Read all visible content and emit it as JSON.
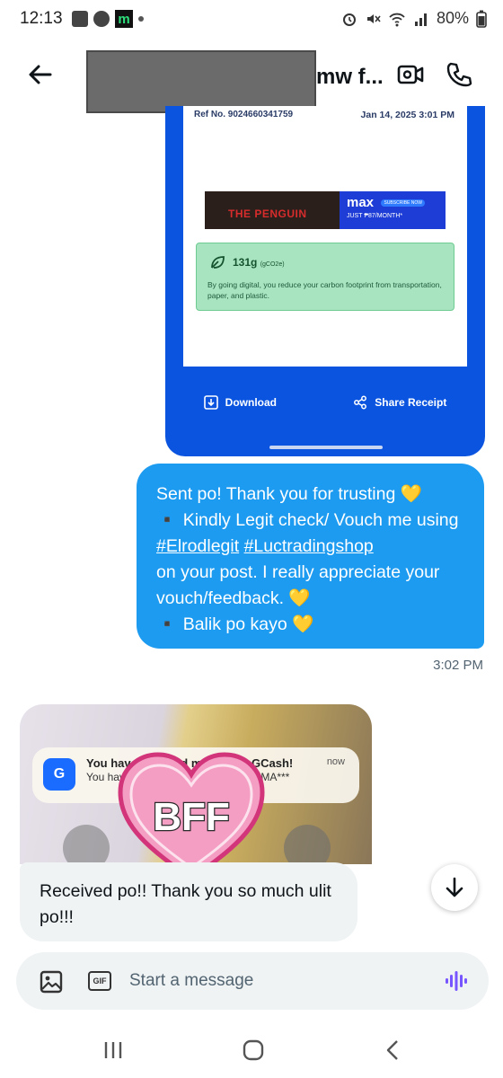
{
  "status_bar": {
    "time": "12:13",
    "battery": "80%"
  },
  "header": {
    "name": "mw f..."
  },
  "receipt": {
    "ref_no": "Ref No. 9024660341759",
    "date": "Jan 14, 2025 3:01 PM",
    "ad_left": "THE PENGUIN",
    "ad_brand": "max",
    "ad_subscribe": "SUBSCRIBE NOW",
    "ad_price": "JUST ₱87/MONTH*",
    "carbon_value": "131g",
    "carbon_unit": "(gCO2e)",
    "carbon_text": "By going digital, you reduce your carbon footprint from transportation, paper, and plastic.",
    "download_label": "Download",
    "share_label": "Share Receipt"
  },
  "messages": {
    "sent_line1": "Sent po! Thank you for trusting 💛",
    "sent_line2": "▪️ Kindly Legit check/ Vouch me using",
    "sent_hashtag1": "#Elrodlegit",
    "sent_hashtag2": "#Luctradingshop",
    "sent_line3": "on your post. I really appreciate your vouch/feedback. 💛",
    "sent_line4": "▪️  Balik po kayo 💛",
    "sent_time": "3:02 PM",
    "notif_title": "You have received money via GCash!",
    "notif_now": "now",
    "notif_body": "You have received ₱ of GCash from MA***",
    "sticker_text": "BFF",
    "received_text": "Received po!! Thank you so much ulit po!!!"
  },
  "composer": {
    "placeholder": "Start a message",
    "gif_label": "GIF"
  },
  "colors": {
    "accent": "#1d9bf0",
    "gcash_blue": "#0a54e0",
    "voice_purple": "#7856ff"
  }
}
